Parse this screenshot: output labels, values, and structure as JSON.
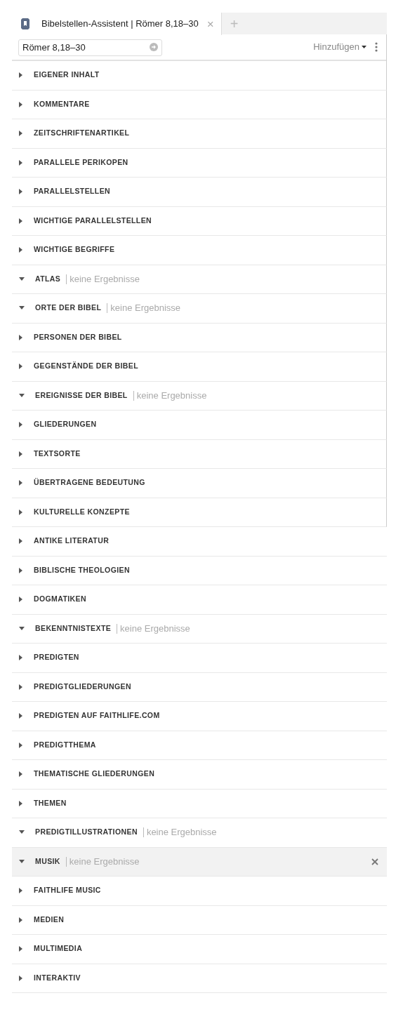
{
  "tabs": [
    {
      "label": "Bibelstellen-Assistent | Römer 8,18–30",
      "selected": true,
      "close": "×"
    }
  ],
  "new_tab": "+",
  "reference_field": {
    "value": "Römer 8,18–30"
  },
  "add_menu": {
    "label": "Hinzufügen"
  },
  "sections": [
    {
      "label": "EIGENER INHALT",
      "expanded": false,
      "selected": false
    },
    {
      "label": "KOMMENTARE",
      "expanded": false,
      "selected": false
    },
    {
      "label": "ZEITSCHRIFTENARTIKEL",
      "expanded": false,
      "selected": false
    },
    {
      "label": "PARALLELE PERIKOPEN",
      "expanded": false,
      "selected": false
    },
    {
      "label": "PARALLELSTELLEN",
      "expanded": false,
      "selected": false
    },
    {
      "label": "WICHTIGE PARALLELSTELLEN",
      "expanded": false,
      "selected": false
    },
    {
      "label": "WICHTIGE BEGRIFFE",
      "expanded": false,
      "selected": false
    },
    {
      "label": "ATLAS",
      "expanded": true,
      "selected": false,
      "note": "keine Ergebnisse"
    },
    {
      "label": "ORTE DER BIBEL",
      "expanded": true,
      "selected": false,
      "note": "keine Ergebnisse"
    },
    {
      "label": "PERSONEN DER BIBEL",
      "expanded": false,
      "selected": false
    },
    {
      "label": "GEGENSTÄNDE DER BIBEL",
      "expanded": false,
      "selected": false
    },
    {
      "label": "EREIGNISSE DER BIBEL",
      "expanded": true,
      "selected": false,
      "note": "keine Ergebnisse"
    },
    {
      "label": "GLIEDERUNGEN",
      "expanded": false,
      "selected": false
    },
    {
      "label": "TEXTSORTE",
      "expanded": false,
      "selected": false
    },
    {
      "label": "ÜBERTRAGENE BEDEUTUNG",
      "expanded": false,
      "selected": false
    },
    {
      "label": "KULTURELLE KONZEPTE",
      "expanded": false,
      "selected": false
    },
    {
      "label": "ANTIKE LITERATUR",
      "expanded": false,
      "selected": false
    },
    {
      "label": "BIBLISCHE THEOLOGIEN",
      "expanded": false,
      "selected": false
    },
    {
      "label": "DOGMATIKEN",
      "expanded": false,
      "selected": false
    },
    {
      "label": "BEKENNTNISTEXTE",
      "expanded": true,
      "selected": false,
      "note": "keine Ergebnisse"
    },
    {
      "label": "PREDIGTEN",
      "expanded": false,
      "selected": false
    },
    {
      "label": "PREDIGTGLIEDERUNGEN",
      "expanded": false,
      "selected": false
    },
    {
      "label": "PREDIGTEN AUF FAITHLIFE.COM",
      "expanded": false,
      "selected": false
    },
    {
      "label": "PREDIGTTHEMA",
      "expanded": false,
      "selected": false
    },
    {
      "label": "THEMATISCHE GLIEDERUNGEN",
      "expanded": false,
      "selected": false
    },
    {
      "label": "THEMEN",
      "expanded": false,
      "selected": false
    },
    {
      "label": "PREDIGTILLUSTRATIONEN",
      "expanded": true,
      "selected": false,
      "note": "keine Ergebnisse"
    },
    {
      "label": "MUSIK",
      "expanded": true,
      "selected": true,
      "note": "keine Ergebnisse"
    },
    {
      "label": "FAITHLIFE MUSIC",
      "expanded": false,
      "selected": false
    },
    {
      "label": "MEDIEN",
      "expanded": false,
      "selected": false
    },
    {
      "label": "MULTIMEDIA",
      "expanded": false,
      "selected": false
    },
    {
      "label": "INTERAKTIV",
      "expanded": false,
      "selected": false
    }
  ]
}
